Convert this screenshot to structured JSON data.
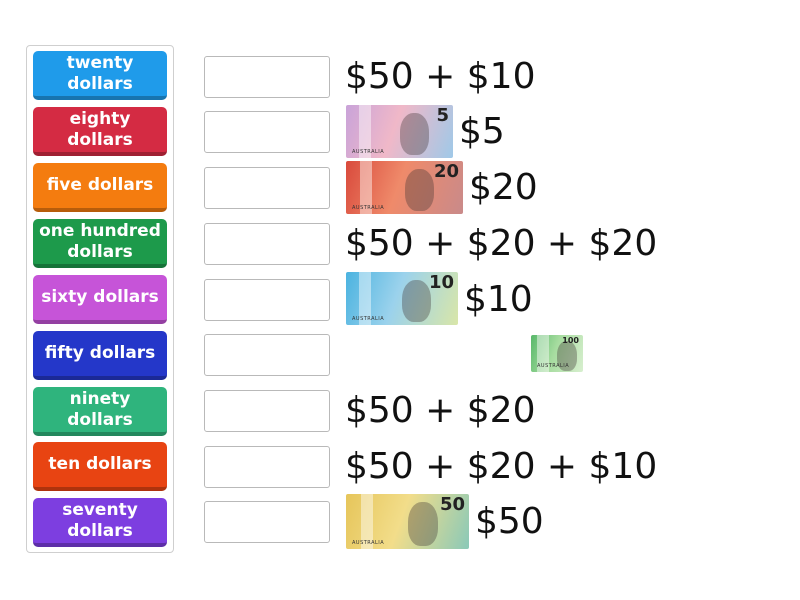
{
  "tiles": [
    {
      "label": "twenty dollars",
      "color": "#1f9bea"
    },
    {
      "label": "eighty dollars",
      "color": "#d42b43"
    },
    {
      "label": "five dollars",
      "color": "#f47c0f"
    },
    {
      "label": "one hundred dollars",
      "color": "#1d9a4b"
    },
    {
      "label": "sixty dollars",
      "color": "#c654d8"
    },
    {
      "label": "fifty dollars",
      "color": "#2437c9"
    },
    {
      "label": "ninety dollars",
      "color": "#2fb47d"
    },
    {
      "label": "ten dollars",
      "color": "#e84412"
    },
    {
      "label": "seventy dollars",
      "color": "#7d3ee0"
    }
  ],
  "rows": [
    {
      "text": "$50 + $10"
    },
    {
      "text": "$5",
      "note": {
        "label": "5",
        "country": "AUSTRALIA",
        "colors": [
          "#c9a3d9",
          "#f0b8c8",
          "#9fc9e8"
        ]
      }
    },
    {
      "text": "$20",
      "note": {
        "label": "20",
        "country": "AUSTRALIA",
        "colors": [
          "#d94a3c",
          "#ef8a6a",
          "#c98a8a"
        ]
      }
    },
    {
      "text": "$50 + $20 + $20"
    },
    {
      "text": "$10",
      "note": {
        "label": "10",
        "country": "AUSTRALIA",
        "colors": [
          "#4bb3e0",
          "#9bd2ec",
          "#d9e6a8"
        ]
      }
    },
    {
      "text": "",
      "note": {
        "label": "100",
        "country": "AUSTRALIA",
        "colors": [
          "#58b86a",
          "#a6dc9f",
          "#d8efcf"
        ]
      }
    },
    {
      "text": "$50 + $20"
    },
    {
      "text": "$50 + $20 + $10"
    },
    {
      "text": "$50",
      "note": {
        "label": "50",
        "country": "AUSTRALIA",
        "colors": [
          "#e6c55a",
          "#f2dd8a",
          "#8ac9b8"
        ]
      }
    }
  ]
}
